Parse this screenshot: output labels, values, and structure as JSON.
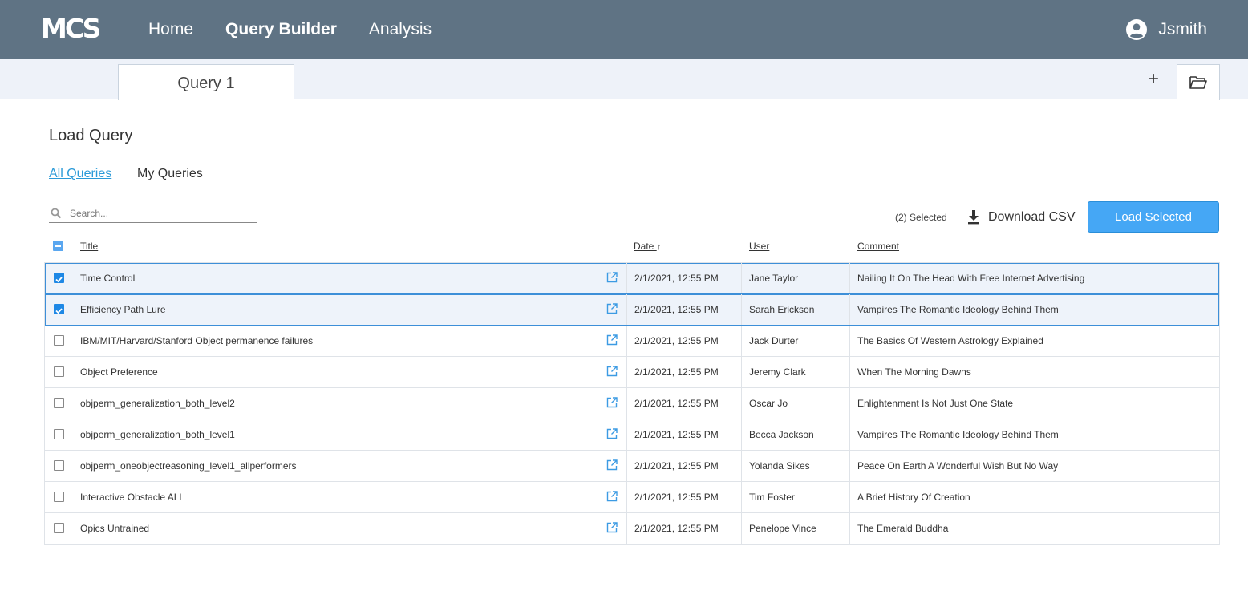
{
  "header": {
    "logo": "MCS",
    "nav": [
      "Home",
      "Query Builder",
      "Analysis"
    ],
    "active_nav": "Query Builder",
    "username": "Jsmith"
  },
  "tabs": {
    "active_tab": "Query 1",
    "add_label": "+"
  },
  "load_query": {
    "title": "Load Query",
    "subtabs": [
      "All Queries",
      "My Queries"
    ],
    "search_placeholder": "Search...",
    "selected_count": "(2) Selected",
    "download_label": "Download CSV",
    "load_button": "Load Selected"
  },
  "table": {
    "columns": [
      "Title",
      "Date",
      "User",
      "Comment"
    ],
    "sort_indicator": "↑",
    "rows": [
      {
        "title": "Time Control",
        "date": "2/1/2021, 12:55 PM",
        "user": "Jane Taylor",
        "comment": "Nailing It On The Head With Free Internet Advertising",
        "selected": true
      },
      {
        "title": "Efficiency Path Lure",
        "date": "2/1/2021, 12:55 PM",
        "user": "Sarah Erickson",
        "comment": "Vampires The Romantic Ideology Behind Them",
        "selected": true
      },
      {
        "title": "IBM/MIT/Harvard/Stanford Object permanence failures",
        "date": "2/1/2021, 12:55 PM",
        "user": "Jack Durter",
        "comment": "The Basics Of Western Astrology Explained",
        "selected": false
      },
      {
        "title": "Object Preference",
        "date": "2/1/2021, 12:55 PM",
        "user": "Jeremy Clark",
        "comment": "When The Morning Dawns",
        "selected": false
      },
      {
        "title": "objperm_generalization_both_level2",
        "date": "2/1/2021, 12:55 PM",
        "user": "Oscar Jo",
        "comment": "Enlightenment Is Not Just One State",
        "selected": false
      },
      {
        "title": "objperm_generalization_both_level1",
        "date": "2/1/2021, 12:55 PM",
        "user": "Becca Jackson",
        "comment": "Vampires The Romantic Ideology Behind Them",
        "selected": false
      },
      {
        "title": "objperm_oneobjectreasoning_level1_allperformers",
        "date": "2/1/2021, 12:55 PM",
        "user": "Yolanda Sikes",
        "comment": "Peace On Earth A Wonderful Wish But No Way",
        "selected": false
      },
      {
        "title": "Interactive Obstacle ALL",
        "date": "2/1/2021, 12:55 PM",
        "user": "Tim Foster",
        "comment": "A Brief History Of Creation",
        "selected": false
      },
      {
        "title": "Opics Untrained",
        "date": "2/1/2021, 12:55 PM",
        "user": "Penelope Vince",
        "comment": "The Emerald Buddha",
        "selected": false
      }
    ]
  },
  "colors": {
    "header_bg": "#5f7384",
    "accent": "#45a7f5",
    "link": "#2a9ad8",
    "checkbox": "#1e88e5"
  },
  "icons": {
    "user": "account-circle-icon",
    "add": "plus-icon",
    "folder": "folder-open-icon",
    "search": "search-icon",
    "download": "download-icon",
    "open": "open-external-icon"
  }
}
